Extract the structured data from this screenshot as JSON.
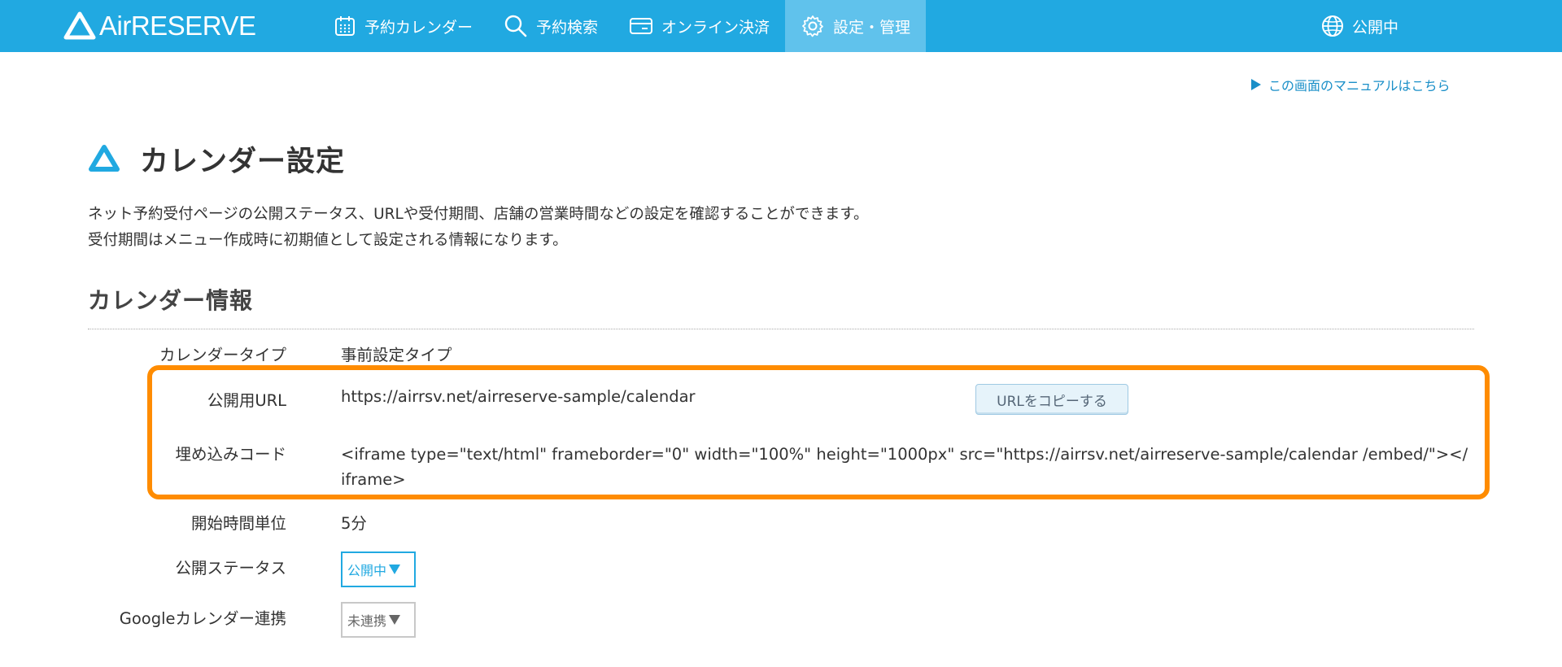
{
  "header": {
    "logo_text": "AirRESERVE",
    "nav": [
      {
        "label": "予約カレンダー",
        "icon": "calendar-icon"
      },
      {
        "label": "予約検索",
        "icon": "search-icon"
      },
      {
        "label": "オンライン決済",
        "icon": "card-icon"
      },
      {
        "label": "設定・管理",
        "icon": "gear-icon",
        "active": true
      }
    ],
    "status_label": "公開中",
    "status_icon": "globe-icon",
    "bg_color": "#21a9e1",
    "active_color": "#60c2ec"
  },
  "manual_link": "この画面のマニュアルはこちら",
  "page": {
    "title": "カレンダー設定",
    "description": [
      "ネット予約受付ページの公開ステータス、URLや受付期間、店舗の営業時間などの設定を確認することができます。",
      "受付期間はメニュー作成時に初期値として設定される情報になります。"
    ]
  },
  "section": {
    "title": "カレンダー情報",
    "rows": {
      "calendar_type": {
        "label": "カレンダータイプ",
        "value": "事前設定タイプ"
      },
      "public_url": {
        "label": "公開用URL",
        "value": "https://airrsv.net/airreserve-sample/calendar",
        "copy_button": "URLをコピーする"
      },
      "embed_code": {
        "label": "埋め込みコード",
        "value": "<iframe type=\"text/html\" frameborder=\"0\" width=\"100%\" height=\"1000px\" src=\"https://airrsv.net/airreserve-sample/calendar /embed/\"></iframe>"
      },
      "start_unit": {
        "label": "開始時間単位",
        "value": "5分"
      },
      "public_status": {
        "label": "公開ステータス",
        "value": "公開中"
      },
      "google_sync": {
        "label": "Googleカレンダー連携",
        "value": "未連携"
      }
    }
  },
  "highlight_color": "#ff8c00"
}
